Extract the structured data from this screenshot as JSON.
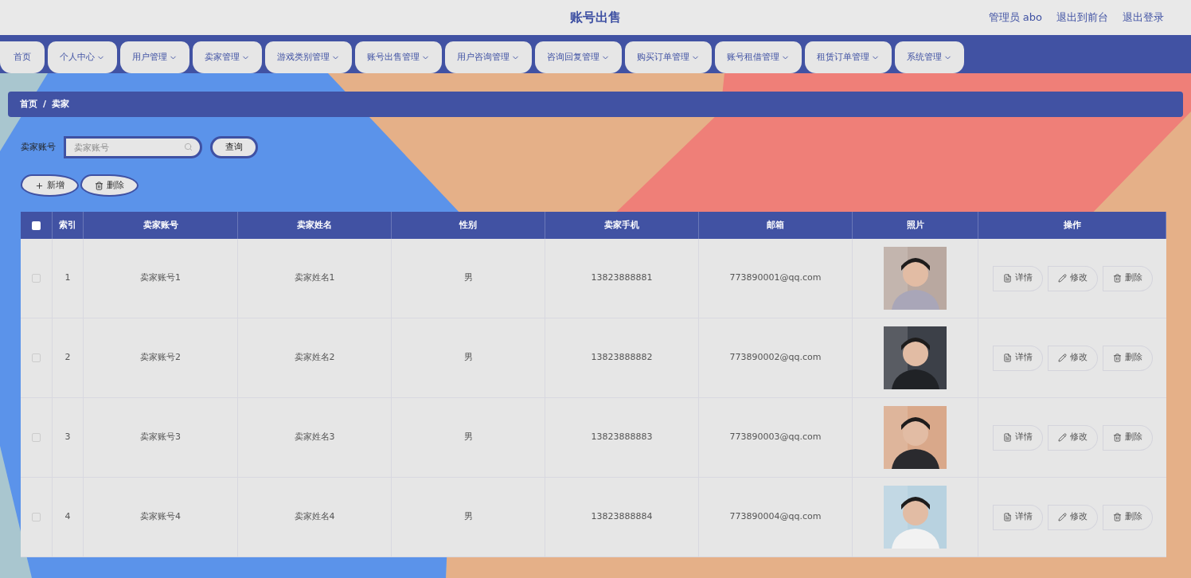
{
  "header": {
    "title": "账号出售",
    "links": [
      "管理员 abo",
      "退出到前台",
      "退出登录"
    ]
  },
  "nav": [
    {
      "label": "首页",
      "kind": "link"
    },
    {
      "label": "个人中心",
      "kind": "menu"
    },
    {
      "label": "用户管理",
      "kind": "menu"
    },
    {
      "label": "卖家管理",
      "kind": "menu"
    },
    {
      "label": "游戏类别管理",
      "kind": "menu"
    },
    {
      "label": "账号出售管理",
      "kind": "menu"
    },
    {
      "label": "用户咨询管理",
      "kind": "menu"
    },
    {
      "label": "咨询回复管理",
      "kind": "menu"
    },
    {
      "label": "购买订单管理",
      "kind": "menu"
    },
    {
      "label": "账号租借管理",
      "kind": "menu"
    },
    {
      "label": "租赁订单管理",
      "kind": "menu"
    },
    {
      "label": "系统管理",
      "kind": "menu"
    }
  ],
  "breadcrumb": [
    "首页",
    "/",
    "卖家"
  ],
  "search": {
    "label": "卖家账号",
    "placeholder": "卖家账号",
    "button": "查询"
  },
  "toolbar": {
    "add": "新增",
    "delete": "删除"
  },
  "table": {
    "header_checked": false,
    "columns": [
      "索引",
      "卖家账号",
      "卖家姓名",
      "性别",
      "卖家手机",
      "邮箱",
      "照片",
      "操作"
    ],
    "rows": [
      {
        "checked": false,
        "cells": [
          "1",
          "卖家账号1",
          "卖家姓名1",
          "男",
          "13823888881",
          "773890001@qq.com"
        ],
        "photo": {
          "kind": "picture"
        },
        "actions": [
          "详情",
          "修改",
          "删除"
        ]
      },
      {
        "checked": false,
        "cells": [
          "2",
          "卖家账号2",
          "卖家姓名2",
          "男",
          "13823888882",
          "773890002@qq.com"
        ],
        "photo": {
          "kind": "picture"
        },
        "actions": [
          "详情",
          "修改",
          "删除"
        ]
      },
      {
        "checked": false,
        "cells": [
          "3",
          "卖家账号3",
          "卖家姓名3",
          "男",
          "13823888883",
          "773890003@qq.com"
        ],
        "photo": {
          "kind": "picture"
        },
        "actions": [
          "详情",
          "修改",
          "删除"
        ]
      },
      {
        "checked": false,
        "cells": [
          "4",
          "卖家账号4",
          "卖家姓名4",
          "男",
          "13823888884",
          "773890004@qq.com"
        ],
        "photo": {
          "kind": "picture"
        },
        "actions": [
          "详情",
          "修改",
          "删除"
        ]
      }
    ]
  }
}
